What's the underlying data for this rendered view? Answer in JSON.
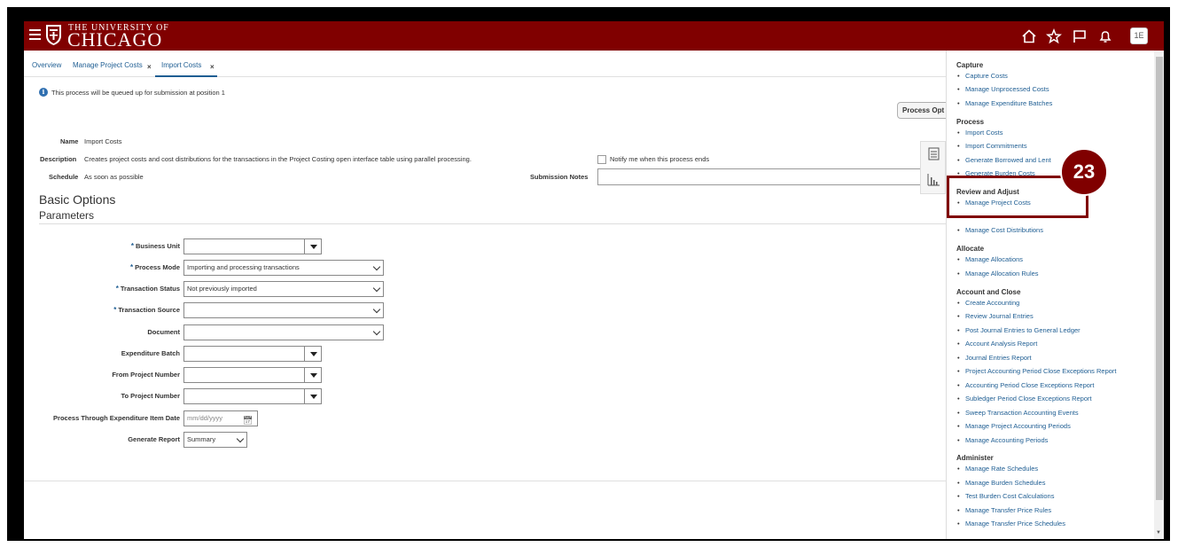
{
  "header": {
    "university_small": "THE UNIVERSITY OF",
    "university_big": "CHICAGO",
    "avatar": "1E"
  },
  "tabs": [
    {
      "label": "Overview"
    },
    {
      "label": "Manage Project Costs",
      "close": "×"
    },
    {
      "label": "Import Costs",
      "close": "×"
    }
  ],
  "info": {
    "icon": "i",
    "message": "This process will be queued up for submission at position 1"
  },
  "process_options_button": "Process Opt",
  "process": {
    "name_label": "Name",
    "name_value": "Import Costs",
    "description_label": "Description",
    "description_value": "Creates project costs and cost distributions for the transactions in the Project Costing open interface table using parallel processing.",
    "schedule_label": "Schedule",
    "schedule_value": "As soon as possible",
    "notify_label": "Notify me when this process ends",
    "submission_notes_label": "Submission Notes"
  },
  "headings": {
    "basic_options": "Basic Options",
    "parameters": "Parameters"
  },
  "parameters": {
    "required_marker": "*",
    "business_unit": {
      "label": "Business Unit",
      "value": ""
    },
    "process_mode": {
      "label": "Process Mode",
      "value": "Importing and processing transactions"
    },
    "transaction_status": {
      "label": "Transaction Status",
      "value": "Not previously imported"
    },
    "transaction_source": {
      "label": "Transaction Source",
      "value": ""
    },
    "document": {
      "label": "Document",
      "value": ""
    },
    "expenditure_batch": {
      "label": "Expenditure Batch",
      "value": ""
    },
    "from_project_number": {
      "label": "From Project Number",
      "value": ""
    },
    "to_project_number": {
      "label": "To Project Number",
      "value": ""
    },
    "process_through_date": {
      "label": "Process Through Expenditure Item Date",
      "placeholder": "mm/dd/yyyy"
    },
    "generate_report": {
      "label": "Generate Report",
      "value": "Summary"
    }
  },
  "panel": {
    "capture": {
      "title": "Capture",
      "items": [
        "Capture Costs",
        "Manage Unprocessed Costs",
        "Manage Expenditure Batches"
      ]
    },
    "process": {
      "title": "Process",
      "items": [
        "Import Costs",
        "Import Commitments",
        "Generate Borrowed and Lent",
        "Generate Burden Costs"
      ]
    },
    "review": {
      "title": "Review and Adjust",
      "items": [
        "Manage Project Costs",
        "Manage Cost Distributions"
      ]
    },
    "allocate": {
      "title": "Allocate",
      "items": [
        "Manage Allocations",
        "Manage Allocation Rules"
      ]
    },
    "account": {
      "title": "Account and Close",
      "items": [
        "Create Accounting",
        "Review Journal Entries",
        "Post Journal Entries to General Ledger",
        "Account Analysis Report",
        "Journal Entries Report",
        "Project Accounting Period Close Exceptions Report",
        "Accounting Period Close Exceptions Report",
        "Subledger Period Close Exceptions Report",
        "Sweep Transaction Accounting Events",
        "Manage Project Accounting Periods",
        "Manage Accounting Periods"
      ]
    },
    "administer": {
      "title": "Administer",
      "items": [
        "Manage Rate Schedules",
        "Manage Burden Schedules",
        "Test Burden Cost Calculations",
        "Manage Transfer Price Rules",
        "Manage Transfer Price Schedules"
      ]
    }
  },
  "step_badge": "23",
  "colors": {
    "brand": "#800000",
    "link": "#1f5e93"
  }
}
